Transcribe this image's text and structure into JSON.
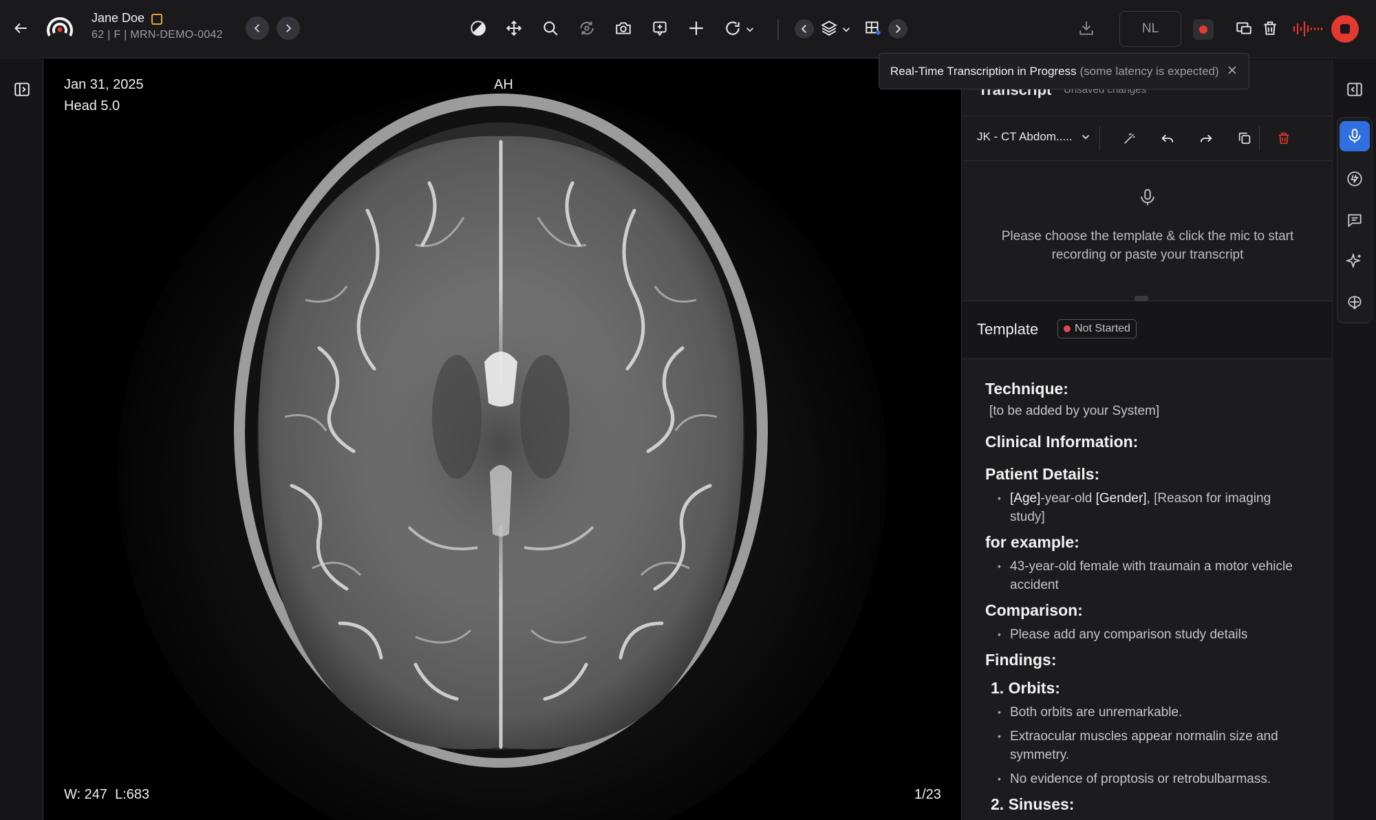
{
  "patient": {
    "name": "Jane Doe",
    "meta": "62 | F | MRN-DEMO-0042"
  },
  "toolbar": {
    "tools": [
      "contrast-icon",
      "pan-icon",
      "zoom-icon",
      "rotate-3d-icon",
      "camera-icon",
      "annotate-icon",
      "crosshair-icon",
      "reset-icon",
      "layers-icon",
      "layout-icon"
    ],
    "language": "NL"
  },
  "viewer": {
    "date": "Jan 31, 2025",
    "series": "Head 5.0",
    "orientation": "AH",
    "window_level": "W: 247  L:683",
    "frame": "1/23"
  },
  "toast": {
    "title": "Real-Time Transcription in Progress",
    "note": "(some latency is expected)"
  },
  "panel": {
    "title_partial": "Transcript",
    "unsaved": "Unsaved changes",
    "template_select": "JK - CT Abdom.....",
    "empty_message": "Please choose the template & click the mic to start recording or paste your transcript",
    "template_label": "Template",
    "status": "Not Started"
  },
  "report": {
    "technique_h": "Technique:",
    "technique_text": "[to be added by your System]",
    "clinical_h": "Clinical Information:",
    "patient_h": "Patient Details:",
    "patient_item": {
      "age": "[Age]",
      "mid": "-year-old ",
      "gender": "[Gender]",
      "rest": ", [Reason for imaging study]"
    },
    "example_h": "for example:",
    "example_item": "43-year-old female with traumain a motor vehicle accident",
    "comparison_h": "Comparison:",
    "comparison_item": "Please add any comparison study details",
    "findings_h": "Findings:",
    "orbits_h": "1. Orbits:",
    "orbits_items": [
      "Both orbits are unremarkable.",
      "Extraocular muscles appear normalin size and symmetry.",
      "No evidence of proptosis or retrobulbarmass."
    ],
    "sinuses_h": "2. Sinuses:"
  },
  "colors": {
    "record_red": "#e5392f",
    "accent_blue": "#2f6fe0",
    "status_dot": "#e0484e",
    "flag": "#e1a82a"
  }
}
